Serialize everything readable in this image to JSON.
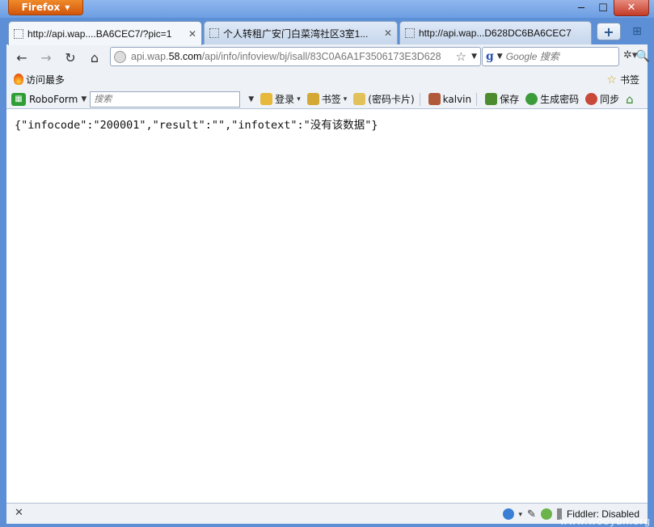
{
  "window": {
    "app_button": "Firefox",
    "minimize": "─",
    "maximize": "☐",
    "close": "✕"
  },
  "tabs": [
    {
      "title": "http://api.wap....BA6CEC7/?pic=1",
      "close": "✕",
      "active": true
    },
    {
      "title": "个人转租广安门白菜湾社区3室1...",
      "close": "✕",
      "active": false
    },
    {
      "title": "http://api.wap...D628DC6BA6CEC7",
      "close": "✕",
      "active": false
    }
  ],
  "tabstrip": {
    "new_tab": "+",
    "list_tabs": "⊞"
  },
  "navbar": {
    "back": "←",
    "forward": "→",
    "reload": "↻",
    "home": "⌂",
    "url_prefix": "api.wap.",
    "url_domain": "58.com",
    "url_path": "/api/info/infoview/bj/isall/83C0A6A1F3506173E3D628",
    "bookmark_star": "☆",
    "url_dropdown": "▼",
    "search_engine_icon": "g",
    "search_placeholder": "Google 搜索",
    "search_button": "🔍",
    "addon": "✲▾"
  },
  "bookmarks_bar": {
    "most_visited": "访问最多",
    "bookmarks": "书签"
  },
  "roboform_bar": {
    "label": "RoboForm",
    "search_placeholder": "搜索",
    "login": "登录",
    "bookmarks": "书签",
    "passcards": "(密码卡片)",
    "user": "kalvin",
    "save": "保存",
    "generate_password": "生成密码",
    "sync": "同步"
  },
  "content": {
    "json_text": "{\"infocode\":\"200001\",\"result\":\"\",\"infotext\":\"没有该数据\"}"
  },
  "statusbar": {
    "close": "✕",
    "fiddler": "Fiddler: Disabled"
  },
  "watermark": "www.wooyun.org"
}
